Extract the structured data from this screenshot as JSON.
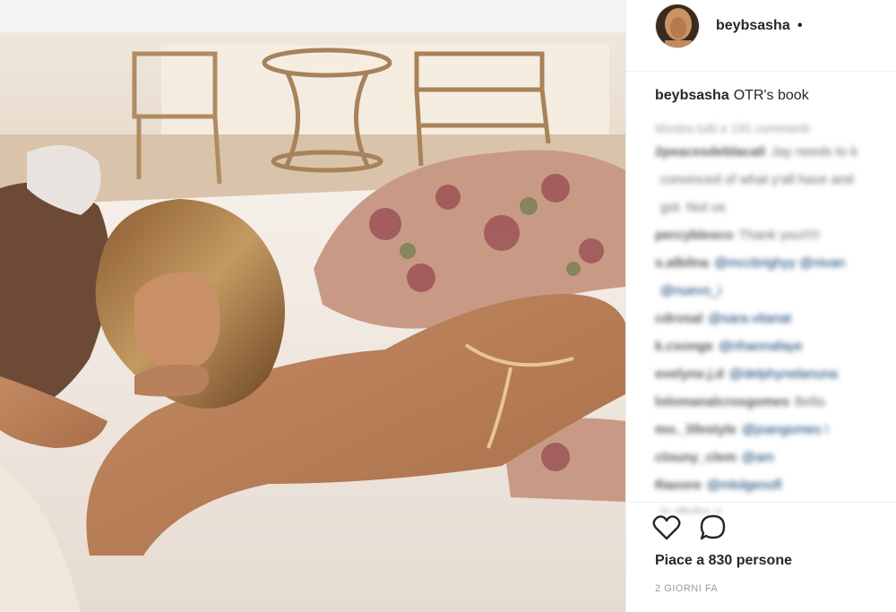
{
  "post": {
    "username": "beybsasha",
    "follow_dot": "•",
    "caption_user": "beybsasha",
    "caption_text": "OTR's book",
    "view_all": "Mostra tutti e 191 commenti",
    "likes": "Piace a 830 persone",
    "timestamp": "2 GIORNI FA"
  },
  "comments": [
    {
      "user": "2peacesdeblacali",
      "text": "Jay needs to k",
      "mention": ""
    },
    {
      "user": "",
      "text": "convinced of what y'all have and",
      "mention": ""
    },
    {
      "user": "",
      "text": "got. Not us",
      "mention": ""
    },
    {
      "user": "percyblesco",
      "text": "Thank you!!!!!",
      "mention": ""
    },
    {
      "user": "s.albilna",
      "text": "",
      "mention": "@mccbrighyy @nivan"
    },
    {
      "user": "",
      "text": "",
      "mention": "@nuevo_i"
    },
    {
      "user": "cdrosal",
      "text": "",
      "mention": "@sara.vitanat"
    },
    {
      "user": "k.csonge",
      "text": "",
      "mention": "@rihannafaye"
    },
    {
      "user": "evelyne.j.d",
      "text": "",
      "mention": "@delphynelanuna"
    },
    {
      "user": "lolomanalcrosgomes",
      "text": "Bella",
      "mention": ""
    },
    {
      "user": "mo._lifestyle",
      "text": "",
      "mention": "@joangomes !"
    },
    {
      "user": "clouny_clem",
      "text": "",
      "mention": "@am"
    },
    {
      "user": "Raoore",
      "text": "",
      "mention": "@mlolgenofl"
    },
    {
      "user": "",
      "text": "je choke a",
      "mention": ""
    }
  ],
  "icons": {
    "like": "heart-icon",
    "comment": "comment-bubble-icon"
  },
  "colors": {
    "text": "#262626",
    "muted": "#999999",
    "border": "#efefef",
    "link": "#003569"
  }
}
